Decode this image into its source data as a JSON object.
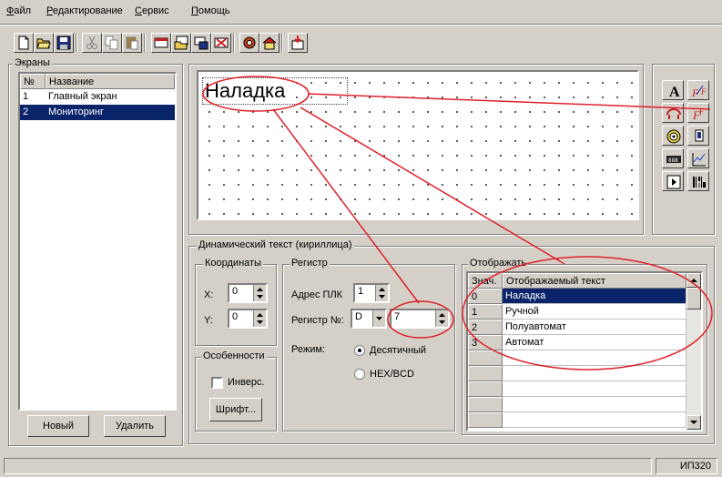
{
  "menu": {
    "items": [
      "Файл",
      "Редактирование",
      "Сервис",
      "Помощь"
    ]
  },
  "screens": {
    "group_label": "Экраны",
    "col_num": "№",
    "col_name": "Название",
    "rows": [
      {
        "num": "1",
        "name": "Главный экран"
      },
      {
        "num": "2",
        "name": "Мониторинг"
      }
    ],
    "selected_index": 1,
    "new_button": "Новый",
    "delete_button": "Удалить"
  },
  "canvas": {
    "text_item": "Наладка"
  },
  "dyntext": {
    "group_label": "Динамический текст (кириллица)",
    "coords": {
      "label": "Координаты",
      "x_label": "X:",
      "x_value": "0",
      "y_label": "Y:",
      "y_value": "0"
    },
    "register": {
      "label": "Регистр",
      "plc_label": "Адрес ПЛК",
      "plc_value": "1",
      "reg_label": "Регистр №:",
      "reg_type": "D",
      "reg_value": "7",
      "mode_label": "Режим:",
      "mode_decimal": "Десятичный",
      "mode_hex": "HEX/BCD",
      "selected_mode": "decimal"
    },
    "features": {
      "label": "Особенности",
      "inverse_label": "Инверс.",
      "inverse_checked": false,
      "font_button": "Шрифт..."
    },
    "display": {
      "label": "Отображать",
      "col_value": "Знач.",
      "col_text": "Отображаемый текст",
      "rows": [
        {
          "value": "0",
          "text": "Наладка"
        },
        {
          "value": "1",
          "text": "Ручной"
        },
        {
          "value": "2",
          "text": "Полуавтомат"
        },
        {
          "value": "3",
          "text": "Автомат"
        }
      ],
      "selected_index": 0
    }
  },
  "status": {
    "device": "ИП320"
  },
  "colors": {
    "selection": "#0a246a",
    "annotation": "#e0202a",
    "face": "#d4d0c8"
  },
  "icons": [
    "new-file-icon",
    "open-folder-icon",
    "save-icon",
    "cut-icon",
    "copy-icon",
    "paste-icon",
    "screen-icon",
    "screen-open-icon",
    "screen-save-icon",
    "screen-delete-icon",
    "settings-icon",
    "home-icon",
    "download-icon",
    "static-text-icon",
    "dynamic-text-icon",
    "bitmap-icon",
    "dynamic-bitmap-icon",
    "lamp-icon",
    "indicator-icon",
    "numeric-display-icon",
    "trend-icon",
    "button-icon",
    "barcode-icon"
  ]
}
